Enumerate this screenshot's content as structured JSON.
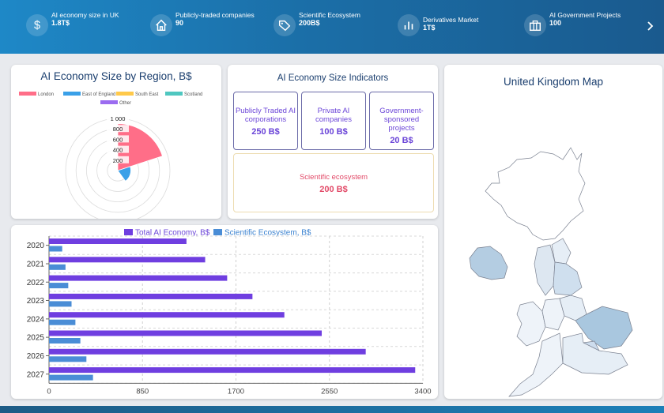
{
  "kpis": [
    {
      "label": "AI economy size in UK",
      "value": "1.8T$",
      "icon": "dollar-icon"
    },
    {
      "label": "Publicly-traded companies",
      "value": "90",
      "icon": "home-icon"
    },
    {
      "label": "Scientific Ecosystem",
      "value": "200B$",
      "icon": "tag-icon"
    },
    {
      "label": "Derivatives Market",
      "value": "1T$",
      "icon": "bar-chart-icon"
    },
    {
      "label": "AI Government Projects",
      "value": "100",
      "icon": "building-icon"
    }
  ],
  "next_icon": "chevron-right-icon",
  "region_chart": {
    "title": "AI Economy Size by Region, B$",
    "legend": [
      "London",
      "East of England",
      "South East",
      "Scotland",
      "Other"
    ],
    "colors": [
      "#ff6e88",
      "#3aa0e8",
      "#ffc94a",
      "#4fc7c0",
      "#9b6cf0"
    ]
  },
  "indicators": {
    "title": "AI Economy Size Indicators",
    "boxes": [
      {
        "label": "Publicly Traded AI corporations",
        "value": "250 B$"
      },
      {
        "label": "Private AI companies",
        "value": "100 B$"
      },
      {
        "label": "Government-sponsored projects",
        "value": "20 B$"
      }
    ],
    "wide": {
      "label": "Scientific ecosystem",
      "value": "200 B$"
    }
  },
  "map": {
    "title": "United Kingdom Map"
  },
  "chart_data": [
    {
      "type": "polar-area",
      "title": "AI Economy Size by Region, B$",
      "categories": [
        "London",
        "East of England",
        "South East",
        "Scotland",
        "Other"
      ],
      "values": [
        900,
        250,
        0,
        0,
        0
      ],
      "radial_ticks": [
        "200",
        "400",
        "600",
        "800",
        "1 000"
      ],
      "rmax": 1000,
      "legend_position": "top"
    },
    {
      "type": "bar",
      "orientation": "horizontal",
      "categories": [
        "2020",
        "2021",
        "2022",
        "2023",
        "2024",
        "2025",
        "2026",
        "2027"
      ],
      "series": [
        {
          "name": "Total AI Economy, B$",
          "color": "#6f3ee0",
          "values": [
            1250,
            1420,
            1620,
            1850,
            2140,
            2480,
            2880,
            3330
          ]
        },
        {
          "name": "Scientific Ecosystem, B$",
          "color": "#4a8dd6",
          "values": [
            120,
            150,
            175,
            205,
            240,
            285,
            340,
            400
          ]
        }
      ],
      "x_ticks": [
        "0",
        "850",
        "1700",
        "2550",
        "3400"
      ],
      "xlim": [
        0,
        3400
      ],
      "legend_position": "top"
    }
  ]
}
